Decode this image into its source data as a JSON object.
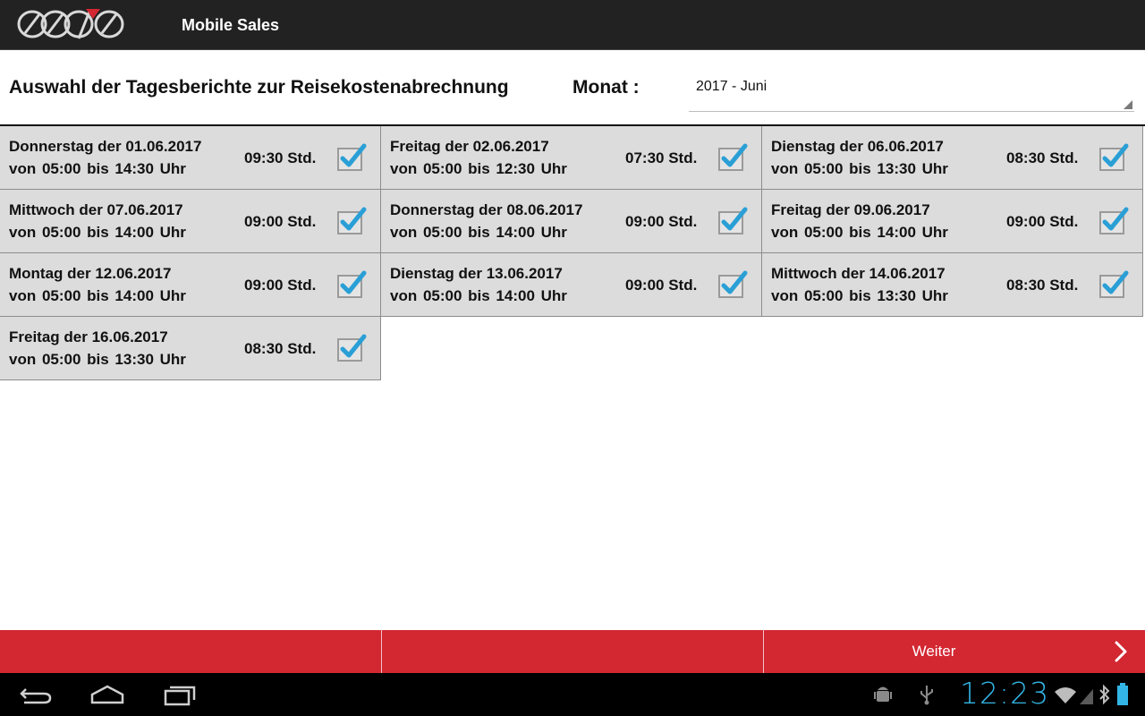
{
  "app": {
    "title": "Mobile Sales",
    "accent": "#d32732",
    "check_color": "#33b5e5"
  },
  "header": {
    "title": "Auswahl der Tagesberichte zur Reisekostenabrechnung",
    "month_label": "Monat :",
    "month_value": "2017 - Juni"
  },
  "days": [
    {
      "title": "Donnerstag der 01.06.2017",
      "time": "von  05:00  bis  14:30 Uhr",
      "hours": "09:30 Std.",
      "checked": true
    },
    {
      "title": "Freitag der 02.06.2017",
      "time": "von  05:00  bis  12:30 Uhr",
      "hours": "07:30 Std.",
      "checked": true
    },
    {
      "title": "Dienstag der 06.06.2017",
      "time": "von  05:00  bis  13:30 Uhr",
      "hours": "08:30 Std.",
      "checked": true
    },
    {
      "title": "Mittwoch der 07.06.2017",
      "time": "von  05:00  bis  14:00 Uhr",
      "hours": "09:00 Std.",
      "checked": true
    },
    {
      "title": "Donnerstag der 08.06.2017",
      "time": "von  05:00  bis  14:00 Uhr",
      "hours": "09:00 Std.",
      "checked": true
    },
    {
      "title": "Freitag der 09.06.2017",
      "time": "von  05:00  bis  14:00 Uhr",
      "hours": "09:00 Std.",
      "checked": true
    },
    {
      "title": "Montag der 12.06.2017",
      "time": "von  05:00  bis  14:00 Uhr",
      "hours": "09:00 Std.",
      "checked": true
    },
    {
      "title": "Dienstag der 13.06.2017",
      "time": "von  05:00  bis  14:00 Uhr",
      "hours": "09:00 Std.",
      "checked": true
    },
    {
      "title": "Mittwoch der 14.06.2017",
      "time": "von  05:00  bis  13:30 Uhr",
      "hours": "08:30 Std.",
      "checked": true
    },
    {
      "title": "Freitag der 16.06.2017",
      "time": "von  05:00  bis  13:30 Uhr",
      "hours": "08:30 Std.",
      "checked": true
    }
  ],
  "buttonbar": {
    "next_label": "Weiter"
  },
  "system": {
    "clock": "12:23",
    "icons": [
      "back-icon",
      "home-icon",
      "recent-apps-icon",
      "android-debug-icon",
      "usb-icon",
      "wifi-icon",
      "signal-icon",
      "bluetooth-icon",
      "battery-icon"
    ]
  }
}
